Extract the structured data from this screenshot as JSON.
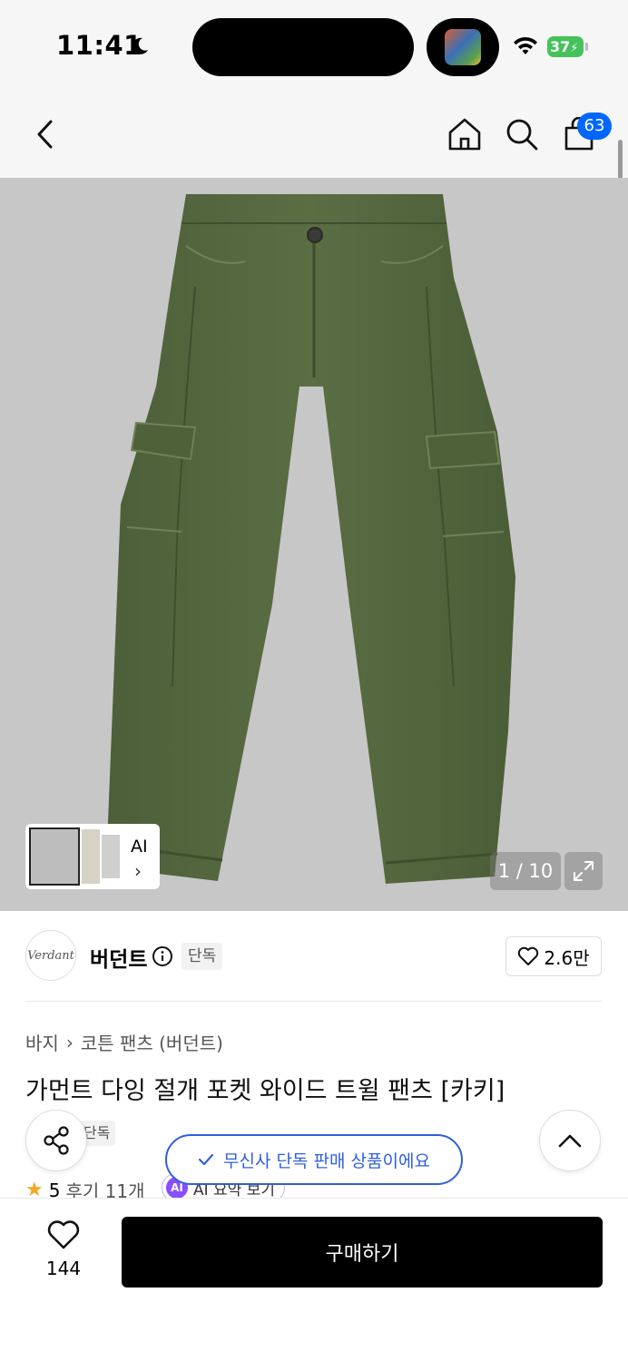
{
  "status_bar": {
    "time": "11:41",
    "battery": "37"
  },
  "header": {
    "cart_count": "63",
    "icons": [
      "back-icon",
      "home-icon",
      "search-icon",
      "cart-icon"
    ]
  },
  "gallery": {
    "counter": "1 / 10",
    "thumb_ai_label": "AI"
  },
  "brand": {
    "name": "버던트",
    "logo_text": "Verdant",
    "exclusive_chip": "단독",
    "likes": "2.6만"
  },
  "product": {
    "breadcrumb": [
      "바지",
      "코튼 팬츠 (버던트)"
    ],
    "title": "가먼트 다잉 절개 포켓 와이드 트윌 팬츠 [카키]",
    "tag": "단독",
    "rating": "5",
    "reviews": "후기 11개",
    "ai_summary": "AI 요약 보기",
    "ai_badge": "AI"
  },
  "toast": {
    "message": "무신사 단독 판매 상품이에요"
  },
  "bottom_bar": {
    "wish_count": "144",
    "buy_label": "구매하기"
  },
  "colors": {
    "accent_blue": "#0066ff",
    "pants_green": "#55683f",
    "hero_bg": "#c7c7c7",
    "ai_purple": "#8a4dff"
  }
}
